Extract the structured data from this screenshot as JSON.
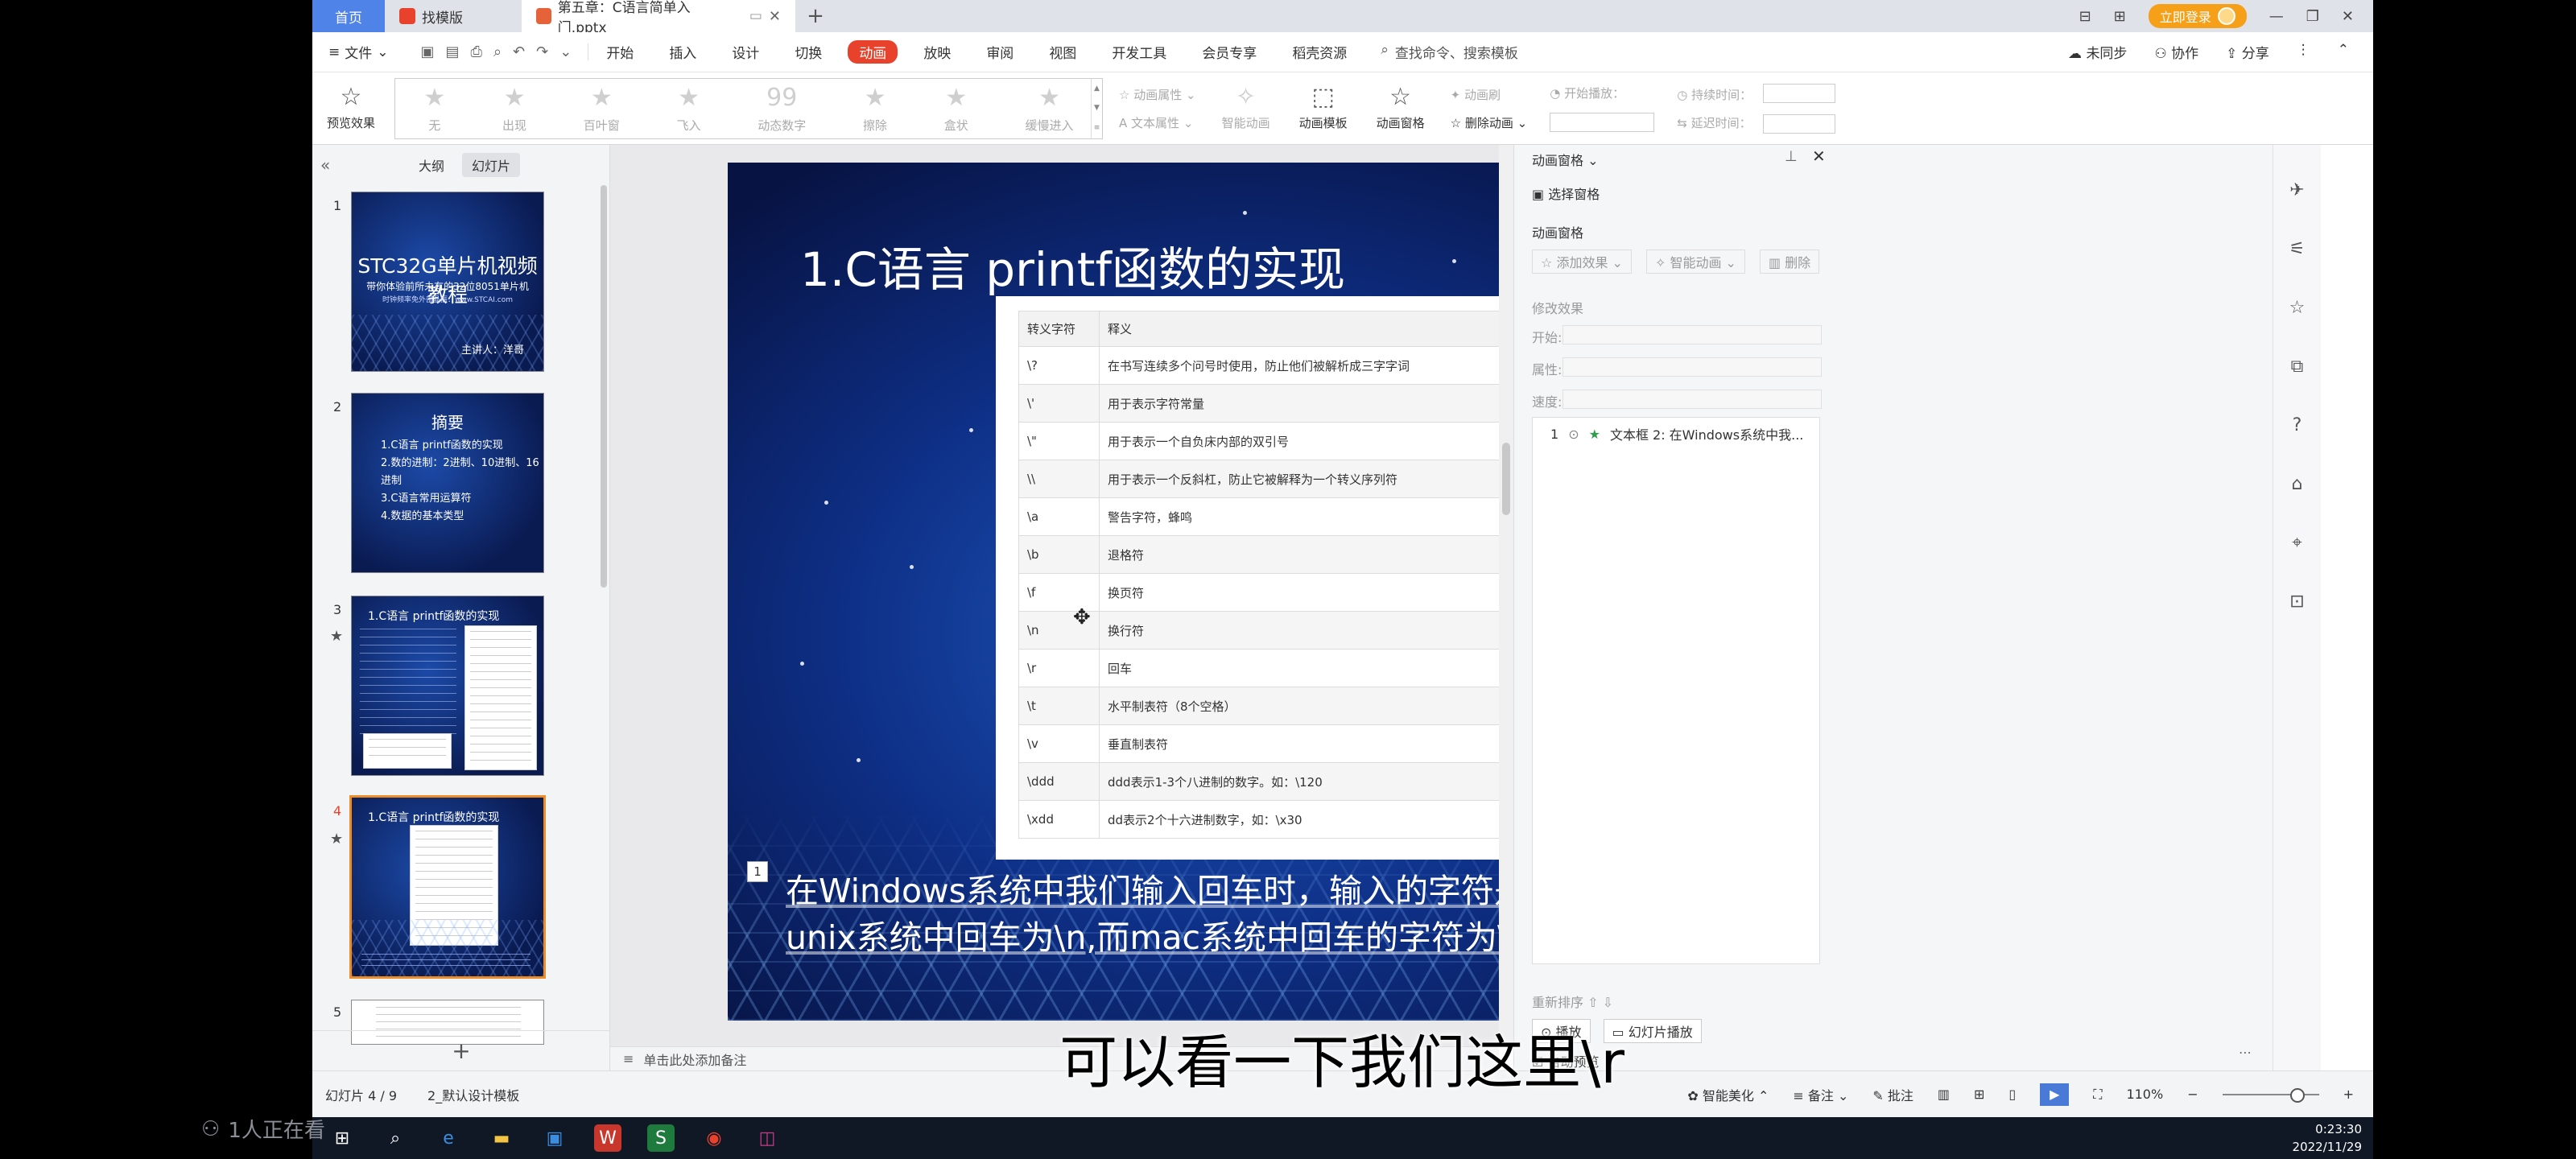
{
  "tabs": {
    "home": "首页",
    "template": "找模版",
    "doc": "第五章：C语言简单入门.pptx"
  },
  "login": "立即登录",
  "menu": {
    "file": "文件",
    "items": [
      "开始",
      "插入",
      "设计",
      "切换",
      "动画",
      "放映",
      "审阅",
      "视图",
      "开发工具",
      "会员专享",
      "稻壳资源"
    ],
    "active_index": 4,
    "search": "查找命令、搜索模板",
    "right": [
      "未同步",
      "协作",
      "分享"
    ]
  },
  "ribbon": {
    "preview": "预览效果",
    "gallery": [
      "无",
      "出现",
      "百叶窗",
      "飞入",
      "动态数字",
      "擦除",
      "盒状",
      "缓慢进入"
    ],
    "col1": [
      "动画属性",
      "文本属性"
    ],
    "smart": "智能动画",
    "template": "动画模板",
    "pane": "动画窗格",
    "col2": [
      "动画刷",
      "删除动画"
    ],
    "col3": [
      "开始播放：",
      ""
    ],
    "col4": [
      "持续时间：",
      "延迟时间："
    ]
  },
  "leftpanel": {
    "tabs": [
      "大纲",
      "幻灯片"
    ],
    "active": 1,
    "thumb1": {
      "title": "STC32G单片机视频教程",
      "sub": "带你体验前所未有的32位8051单片机",
      "sub2": "时钟频率免外部晶振：www.STCAI.com",
      "speaker": "主讲人：洋哥"
    },
    "thumb2": {
      "title": "摘要",
      "items": [
        "1.C语言 printf函数的实现",
        "2.数的进制：2进制、10进制、16进制",
        "3.C语言常用运算符",
        "4.数据的基本类型"
      ]
    },
    "thumb3": {
      "title": "1.C语言 printf函数的实现"
    },
    "thumb4": {
      "title": "1.C语言 printf函数的实现"
    }
  },
  "slide": {
    "title": "1.C语言 printf函数的实现",
    "table": {
      "headers": [
        "转义字符",
        "释义"
      ],
      "rows": [
        [
          "\\?",
          "在书写连续多个问号时使用，防止他们被解析成三字字词"
        ],
        [
          "\\'",
          "用于表示字符常量"
        ],
        [
          "\\\"",
          "用于表示一个自负床内部的双引号"
        ],
        [
          "\\\\",
          "用于表示一个反斜杠，防止它被解释为一个转义序列符"
        ],
        [
          "\\a",
          "警告字符，蜂鸣"
        ],
        [
          "\\b",
          "退格符"
        ],
        [
          "\\f",
          "换页符"
        ],
        [
          "\\n",
          "换行符"
        ],
        [
          "\\r",
          "回车"
        ],
        [
          "\\t",
          "水平制表符（8个空格）"
        ],
        [
          "\\v",
          "垂直制表符"
        ],
        [
          "\\ddd",
          "ddd表示1-3个八进制的数字。如：\\120"
        ],
        [
          "\\xdd",
          "dd表示2个十六进制数字，如：\\x30"
        ]
      ]
    },
    "marker": "1",
    "body": [
      "在Windows系统中我们输入回车时，输入的字符是\\r\\n，",
      "unix系统中回车为\\n,而mac系统中回车的字符为\\r."
    ]
  },
  "notes": "单击此处添加备注",
  "rightpane": {
    "title": "动画窗格",
    "select_pane": "选择窗格",
    "section": "动画窗格",
    "buttons": [
      "添加效果",
      "智能动画",
      "删除"
    ],
    "modify": "修改效果",
    "fields": [
      "开始:",
      "属性:",
      "速度:"
    ],
    "item": {
      "num": "1",
      "text": "文本框 2: 在Windows系统中我..."
    },
    "reorder": "重新排序",
    "play": "播放",
    "slideshow": "幻灯片播放",
    "autopreview": "自动预览"
  },
  "status": {
    "slide": "幻灯片 4 / 9",
    "template": "2_默认设计模板",
    "beautify": "智能美化",
    "notes": "备注",
    "comment": "批注",
    "zoom": "110%"
  },
  "caption": "可以看一下我们这里\\r",
  "viewer": "1人正在看",
  "clock": {
    "time": "0:23:30",
    "date": "2022/11/29"
  },
  "colors": {
    "accent": "#e8412c",
    "home_tab": "#4f83e8",
    "login": "#f6a019",
    "selected_thumb": "#f08c24"
  }
}
